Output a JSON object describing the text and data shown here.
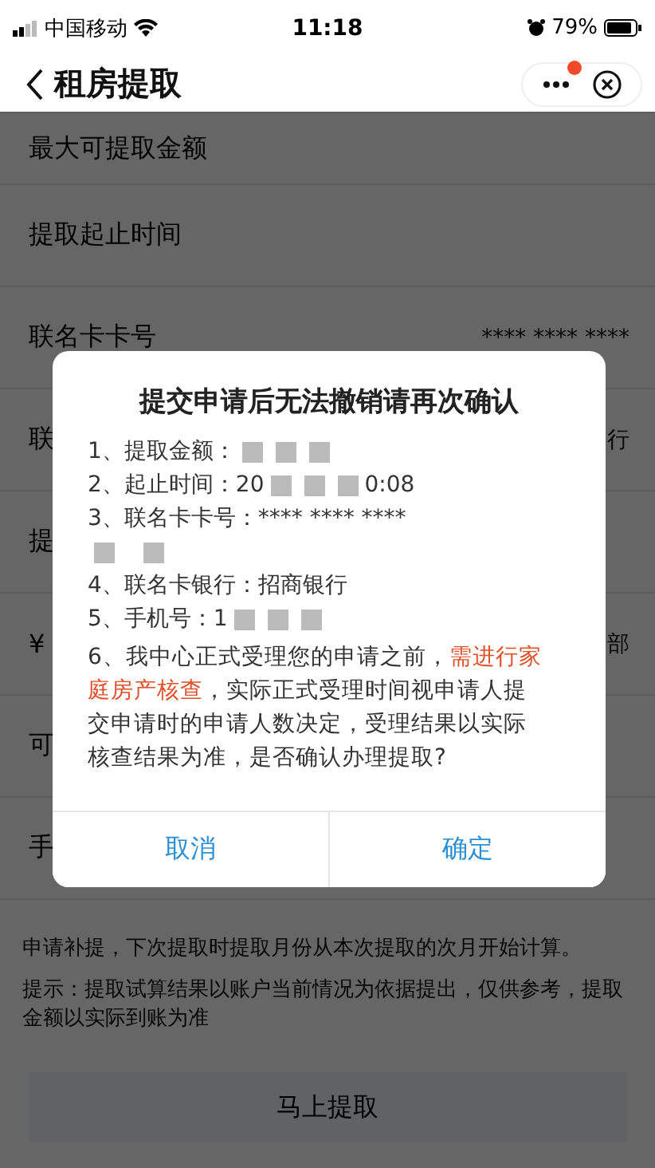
{
  "status_bar": {
    "carrier": "中国移动",
    "time": "11:18",
    "battery": "79%"
  },
  "nav": {
    "title": "租房提取"
  },
  "page": {
    "rows": [
      {
        "label": "最大可提取金额",
        "value": ""
      },
      {
        "label": "提取起止时间",
        "value": ""
      },
      {
        "label": "联名卡卡号",
        "value": "**** **** ****"
      },
      {
        "label": "联",
        "value": "行"
      },
      {
        "label": "提",
        "value": ""
      },
      {
        "label": "¥",
        "value": "部"
      },
      {
        "label": "可",
        "value": ""
      },
      {
        "label": "手",
        "value": ""
      }
    ],
    "notice": "申请补提，下次提取时提取月份从本次提取的次月开始计算。",
    "tip": "提示：提取试算结果以账户当前情况为依据提出，仅供参考，提取金额以实际到账为准",
    "submit_button": "马上提取"
  },
  "dialog": {
    "title": "提交申请后无法撤销请再次确认",
    "lines": [
      {
        "text": "1、提取金额：",
        "kind": "inline"
      },
      {
        "text": "2、起止时间：20",
        "kind": "inline",
        "tail": "0:08"
      },
      {
        "text": "3、联名卡卡号：**** **** ****",
        "kind": "below"
      },
      {
        "text": "4、联名卡银行：招商银行",
        "kind": "plain"
      },
      {
        "text": "5、手机号：1",
        "kind": "inline"
      }
    ],
    "statement": [
      {
        "text": "6、我中心正式受理您的申请之前，",
        "highlight": false
      },
      {
        "text": "需进行家庭房产核查",
        "highlight": true
      },
      {
        "text": "，实际正式受理时间视申请人提交申请时的申请人数决定，受理结果以实际核查结果为准，是否确认办理提取?",
        "highlight": false
      }
    ],
    "buttons": [
      "取消",
      "确定"
    ]
  }
}
